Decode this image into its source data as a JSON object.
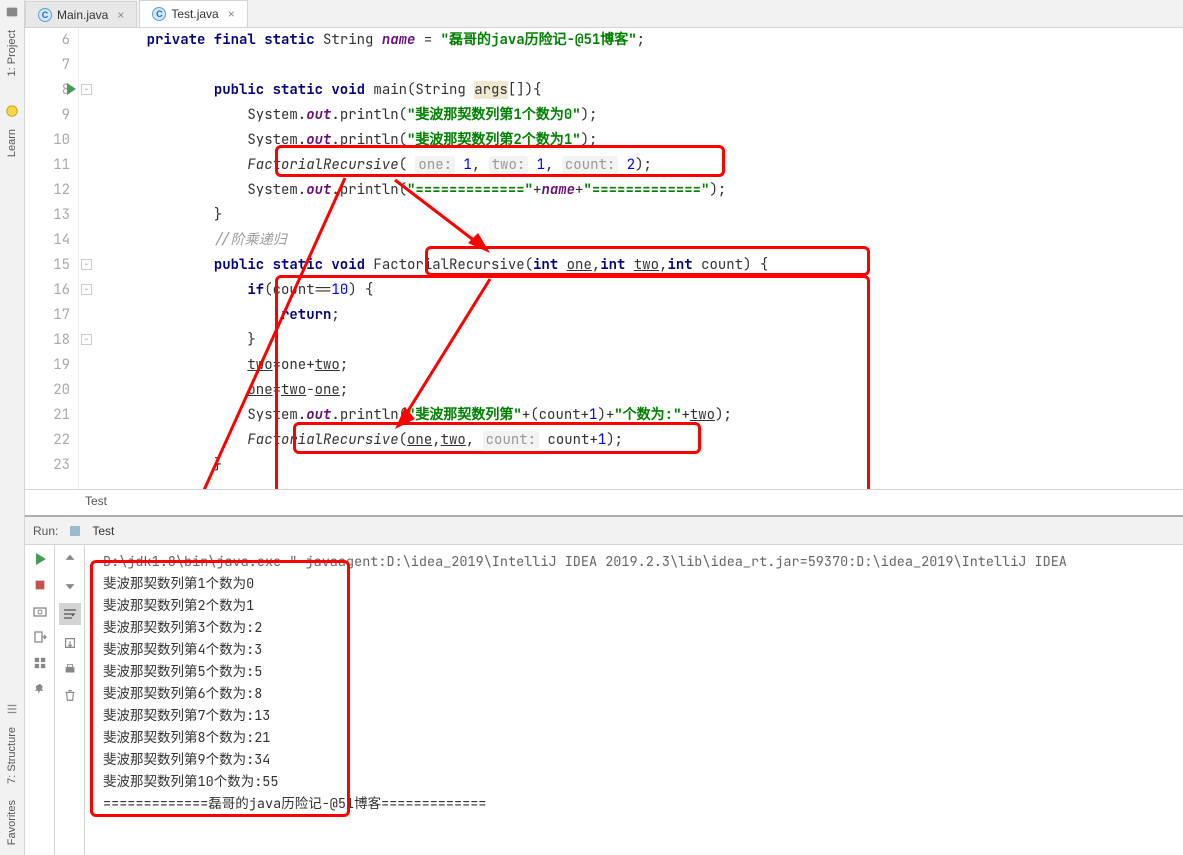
{
  "sidebars": {
    "project": "1: Project",
    "learn": "Learn",
    "structure": "7: Structure",
    "favorites": "Favorites"
  },
  "tabs": [
    {
      "icon": "C",
      "label": "Main.java",
      "active": false
    },
    {
      "icon": "C",
      "label": "Test.java",
      "active": true
    }
  ],
  "gutter": [
    "6",
    "7",
    "8",
    "9",
    "10",
    "11",
    "12",
    "13",
    "14",
    "15",
    "16",
    "17",
    "18",
    "19",
    "20",
    "21",
    "22",
    "23"
  ],
  "code": {
    "l6_kw1": "private final static",
    "l6_type": "String",
    "l6_name": "name",
    "l6_eq": " = ",
    "l6_str": "\"磊哥的java历险记-@51博客\"",
    "l6_end": ";",
    "l8_kw": "public static void ",
    "l8_m": "main(String ",
    "l8_args": "args",
    "l8_end": "[]){",
    "l9_sys": "System.",
    "l9_out": "out",
    "l9_pr": ".println(",
    "l9_str": "\"斐波那契数列第1个数为0\"",
    "l9_end": ");",
    "l10_sys": "System.",
    "l10_out": "out",
    "l10_pr": ".println(",
    "l10_str": "\"斐波那契数列第2个数为1\"",
    "l10_end": ");",
    "l11_call": "FactorialRecursive",
    "l11_open": "( ",
    "l11_h1": "one:",
    "l11_v1": " 1",
    "l11_c1": ", ",
    "l11_h2": "two:",
    "l11_v2": " 1",
    "l11_c2": ", ",
    "l11_h3": "count:",
    "l11_v3": " 2",
    "l11_end": ");",
    "l12_sys": "System.",
    "l12_out": "out",
    "l12_pr": ".println(",
    "l12_str1": "\"=============\"",
    "l12_plus1": "+",
    "l12_nm": "name",
    "l12_plus2": "+",
    "l12_str2": "\"=============\"",
    "l12_end": ");",
    "l13": "}",
    "l14": "//阶乘递归",
    "l15_kw": "public static void",
    "l15_sp1": " ",
    "l15_name": "FactorialRecursive(",
    "l15_int1": "int ",
    "l15_p1": "one",
    "l15_c1": ",",
    "l15_int2": "int ",
    "l15_p2": "two",
    "l15_c2": ",",
    "l15_int3": "int ",
    "l15_p3": "count) {",
    "l16_if": "if",
    "l16_cond": "(count==",
    "l16_10": "10",
    "l16_end": ") {",
    "l17_ret": "return",
    "l17_end": ";",
    "l18": "}",
    "l19_two": "two",
    "l19_eq": "=one+",
    "l19_two2": "two",
    "l19_end": ";",
    "l20_one": "one",
    "l20_eq": "=",
    "l20_two": "two",
    "l20_minus": "-",
    "l20_one2": "one",
    "l20_end": ";",
    "l21_sys": "System.",
    "l21_out": "out",
    "l21_pr": ".println(",
    "l21_str": "\"斐波那契数列第\"",
    "l21_p1": "+(count+",
    "l21_1": "1",
    "l21_p2": ")+",
    "l21_str2": "\"个数为:\"",
    "l21_p3": "+",
    "l21_two": "two",
    "l21_end": ");",
    "l22_call": "FactorialRecursive",
    "l22_open": "(",
    "l22_one": "one",
    "l22_c1": ",",
    "l22_two": "two",
    "l22_c2": ", ",
    "l22_hint": "count:",
    "l22_sp": " count+",
    "l22_1": "1",
    "l22_end": ");"
  },
  "breadcrumb": "Test",
  "run": {
    "label": "Run:",
    "config": "Test",
    "cmd": "D:\\jdk1.8\\bin\\java.exe \"-javaagent:D:\\idea_2019\\IntelliJ IDEA 2019.2.3\\lib\\idea_rt.jar=59370:D:\\idea_2019\\IntelliJ IDEA",
    "out": [
      "斐波那契数列第1个数为0",
      "斐波那契数列第2个数为1",
      "斐波那契数列第3个数为:2",
      "斐波那契数列第4个数为:3",
      "斐波那契数列第5个数为:5",
      "斐波那契数列第6个数为:8",
      "斐波那契数列第7个数为:13",
      "斐波那契数列第8个数为:21",
      "斐波那契数列第9个数为:34",
      "斐波那契数列第10个数为:55",
      "=============磊哥的java历险记-@51博客============="
    ]
  }
}
